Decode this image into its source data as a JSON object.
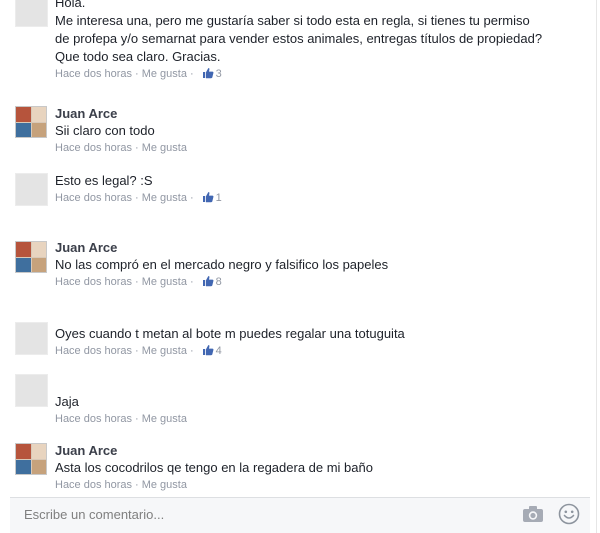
{
  "comments": [
    {
      "author": "",
      "text_lines": [
        "Hola.",
        "Me interesa una, pero me gustaría saber si todo esta en regla, si tienes tu permiso",
        "de profepa y/o semarnat para vender estos animales, entregas títulos de propiedad?",
        "Que todo sea claro. Gracias."
      ],
      "time": "Hace dos horas",
      "like_label": "Me gusta",
      "likes": "3",
      "avatar": "placeholder"
    },
    {
      "author": "Juan Arce",
      "text_lines": [
        "Sii claro con todo"
      ],
      "time": "Hace dos horas",
      "like_label": "Me gusta",
      "likes": "",
      "avatar": "photo"
    },
    {
      "author": "",
      "text_lines": [
        "Esto es legal? :S"
      ],
      "time": "Hace dos horas",
      "like_label": "Me gusta",
      "likes": "1",
      "avatar": "placeholder"
    },
    {
      "author": "Juan Arce",
      "text_lines": [
        "No las compró en el mercado negro y falsifico los papeles"
      ],
      "time": "Hace dos horas",
      "like_label": "Me gusta",
      "likes": "8",
      "avatar": "photo"
    },
    {
      "author": "",
      "text_lines": [
        "Oyes cuando t metan al bote m puedes regalar una totuguita"
      ],
      "time": "Hace dos horas",
      "like_label": "Me gusta",
      "likes": "4",
      "avatar": "placeholder"
    },
    {
      "author": "",
      "text_lines": [
        "Jaja"
      ],
      "time": "Hace dos horas",
      "like_label": "Me gusta",
      "likes": "",
      "avatar": "placeholder"
    },
    {
      "author": "Juan Arce",
      "text_lines": [
        "Asta los cocodrilos qe tengo en la regadera de mi baño"
      ],
      "time": "Hace dos horas",
      "like_label": "Me gusta",
      "likes": "",
      "avatar": "photo"
    }
  ],
  "composer": {
    "placeholder": "Escribe un comentario...",
    "icons": [
      "camera-icon",
      "emoji-icon"
    ]
  },
  "colors": {
    "text": "#1d2129",
    "meta": "#9197a3",
    "link": "#4267b2"
  }
}
